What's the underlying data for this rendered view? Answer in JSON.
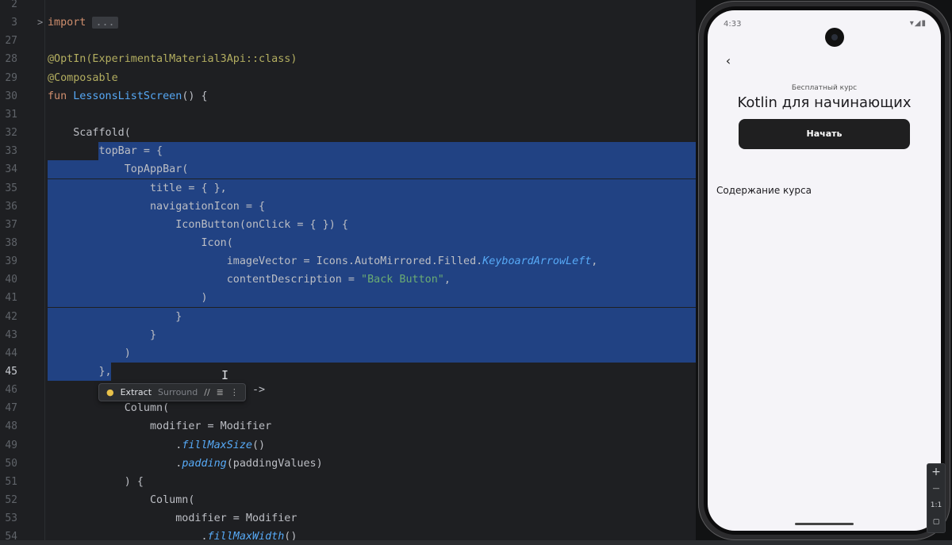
{
  "editor": {
    "lines": [
      {
        "num": "2",
        "segments": []
      },
      {
        "num": "3",
        "segments": [
          {
            "t": "import ",
            "c": "kw"
          },
          {
            "t": "...",
            "c": "ellip"
          }
        ],
        "fold": ">"
      },
      {
        "num": "27",
        "segments": []
      },
      {
        "num": "28",
        "segments": [
          {
            "t": "@OptIn(ExperimentalMaterial3Api::class)",
            "c": "ann"
          }
        ]
      },
      {
        "num": "29",
        "segments": [
          {
            "t": "@Composable",
            "c": "ann"
          }
        ]
      },
      {
        "num": "30",
        "segments": [
          {
            "t": "fun ",
            "c": "kw"
          },
          {
            "t": "LessonsListScreen",
            "c": "fn"
          },
          {
            "t": "() {",
            "c": ""
          }
        ]
      },
      {
        "num": "31",
        "segments": []
      },
      {
        "num": "32",
        "segments": [
          {
            "t": "    Scaffold(",
            "c": ""
          }
        ]
      },
      {
        "num": "33",
        "segments": [
          {
            "t": "        topBar = {",
            "c": ""
          }
        ]
      },
      {
        "num": "34",
        "segments": [
          {
            "t": "            TopAppBar(",
            "c": ""
          }
        ]
      },
      {
        "num": "35",
        "segments": [
          {
            "t": "                title = { },",
            "c": ""
          }
        ]
      },
      {
        "num": "36",
        "segments": [
          {
            "t": "                navigationIcon = {",
            "c": ""
          }
        ]
      },
      {
        "num": "37",
        "segments": [
          {
            "t": "                    IconButton(onClick = { }) {",
            "c": ""
          }
        ]
      },
      {
        "num": "38",
        "segments": [
          {
            "t": "                        Icon(",
            "c": ""
          }
        ]
      },
      {
        "num": "39",
        "segments": [
          {
            "t": "                            imageVector = Icons.AutoMirrored.Filled.",
            "c": ""
          },
          {
            "t": "KeyboardArrowLeft",
            "c": "italic"
          },
          {
            "t": ",",
            "c": ""
          }
        ]
      },
      {
        "num": "40",
        "segments": [
          {
            "t": "                            contentDescription = ",
            "c": ""
          },
          {
            "t": "\"Back Button\"",
            "c": "str"
          },
          {
            "t": ",",
            "c": ""
          }
        ]
      },
      {
        "num": "41",
        "segments": [
          {
            "t": "                        )",
            "c": ""
          }
        ]
      },
      {
        "num": "42",
        "segments": [
          {
            "t": "                    }",
            "c": ""
          }
        ]
      },
      {
        "num": "43",
        "segments": [
          {
            "t": "                }",
            "c": ""
          }
        ]
      },
      {
        "num": "44",
        "segments": [
          {
            "t": "            )",
            "c": ""
          }
        ]
      },
      {
        "num": "45",
        "segments": [
          {
            "t": "        },",
            "c": ""
          }
        ],
        "current": true
      },
      {
        "num": "46",
        "segments": [
          {
            "t": "                             es ->",
            "c": ""
          }
        ]
      },
      {
        "num": "47",
        "segments": [
          {
            "t": "            Column(",
            "c": ""
          }
        ]
      },
      {
        "num": "48",
        "segments": [
          {
            "t": "                modifier = Modifier",
            "c": ""
          }
        ]
      },
      {
        "num": "49",
        "segments": [
          {
            "t": "                    .",
            "c": ""
          },
          {
            "t": "fillMaxSize",
            "c": "italic"
          },
          {
            "t": "()",
            "c": ""
          }
        ]
      },
      {
        "num": "50",
        "segments": [
          {
            "t": "                    .",
            "c": ""
          },
          {
            "t": "padding",
            "c": "italic"
          },
          {
            "t": "(paddingValues)",
            "c": ""
          }
        ]
      },
      {
        "num": "51",
        "segments": [
          {
            "t": "            ) {",
            "c": ""
          }
        ]
      },
      {
        "num": "52",
        "segments": [
          {
            "t": "                Column(",
            "c": ""
          }
        ]
      },
      {
        "num": "53",
        "segments": [
          {
            "t": "                    modifier = Modifier",
            "c": ""
          }
        ]
      },
      {
        "num": "54",
        "segments": [
          {
            "t": "                        .",
            "c": ""
          },
          {
            "t": "fillMaxWidth",
            "c": "italic"
          },
          {
            "t": "()",
            "c": ""
          }
        ]
      }
    ],
    "popup": {
      "extract": "Extract",
      "surround": "Surround"
    }
  },
  "phone": {
    "status_time": "4:33",
    "course_subtitle": "Бесплатный курс",
    "course_title": "Kotlin для начинающих",
    "start_button": "Начать",
    "contents_label": "Содержание курса"
  },
  "emulator": {
    "zoom_in": "+",
    "zoom_ratio": "1:1"
  }
}
